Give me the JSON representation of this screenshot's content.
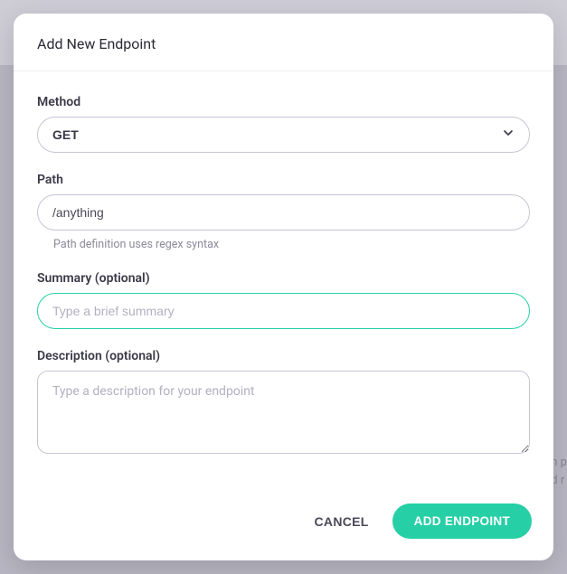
{
  "modal": {
    "title": "Add New Endpoint",
    "fields": {
      "method": {
        "label": "Method",
        "value": "GET"
      },
      "path": {
        "label": "Path",
        "value": "/anything",
        "helper": "Path definition uses regex syntax"
      },
      "summary": {
        "label": "Summary (optional)",
        "placeholder": "Type a brief summary",
        "value": ""
      },
      "description": {
        "label": "Description (optional)",
        "placeholder": "Type a description for your endpoint",
        "value": ""
      }
    },
    "buttons": {
      "cancel": "CANCEL",
      "submit": "ADD ENDPOINT"
    }
  },
  "background": {
    "side_fragment": "n p\nd r"
  },
  "colors": {
    "accent": "#27cfa6",
    "border": "#c8c5d6",
    "text_primary": "#3a3947"
  }
}
